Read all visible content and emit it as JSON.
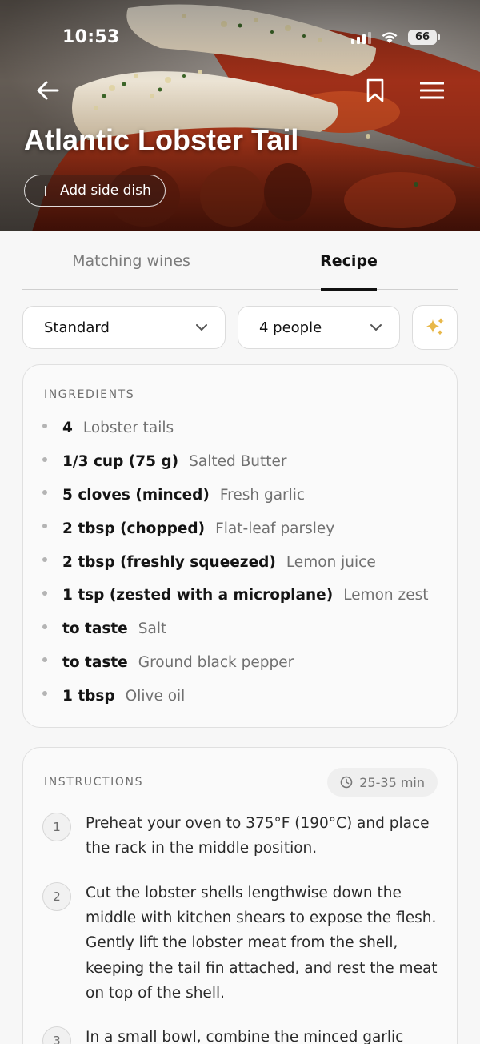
{
  "status_bar": {
    "time": "10:53",
    "battery": "66"
  },
  "hero": {
    "title": "Atlantic Lobster Tail",
    "add_side_dish_label": "Add side dish"
  },
  "tabs": [
    {
      "label": "Matching wines",
      "active": false
    },
    {
      "label": "Recipe",
      "active": true
    }
  ],
  "selectors": {
    "style": "Standard",
    "servings": "4 people"
  },
  "ingredients": {
    "heading": "INGREDIENTS",
    "items": [
      {
        "qty": "4",
        "name": "Lobster tails"
      },
      {
        "qty": "1/3 cup (75 g)",
        "name": "Salted Butter"
      },
      {
        "qty": "5 cloves (minced)",
        "name": "Fresh garlic"
      },
      {
        "qty": "2 tbsp (chopped)",
        "name": "Flat-leaf parsley"
      },
      {
        "qty": "2 tbsp (freshly squeezed)",
        "name": "Lemon juice"
      },
      {
        "qty": "1 tsp (zested with a microplane)",
        "name": "Lemon zest"
      },
      {
        "qty": "to taste",
        "name": "Salt"
      },
      {
        "qty": "to taste",
        "name": "Ground black pepper"
      },
      {
        "qty": "1 tbsp",
        "name": "Olive oil"
      }
    ]
  },
  "instructions": {
    "heading": "INSTRUCTIONS",
    "time": "25-35 min",
    "steps": [
      {
        "num": "1",
        "text": "Preheat your oven to 375°F (190°C) and place the rack in the middle position."
      },
      {
        "num": "2",
        "text": "Cut the lobster shells lengthwise down the middle with kitchen shears to expose the flesh. Gently lift the lobster meat from the shell, keeping the tail fin attached, and rest the meat on top of the shell."
      },
      {
        "num": "3",
        "text": "In a small bowl, combine the minced garlic"
      }
    ]
  },
  "colors": {
    "accent": "#111111",
    "sparkle": "#e8b84a",
    "muted_text": "#707070"
  }
}
